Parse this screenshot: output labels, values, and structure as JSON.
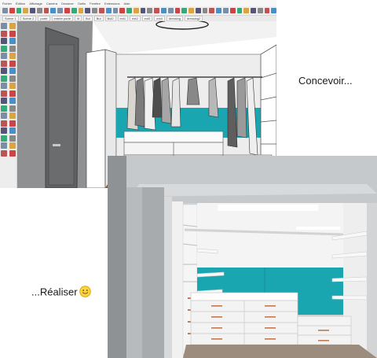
{
  "sketchup": {
    "menu": [
      "Fichier",
      "Édition",
      "Affichage",
      "Caméra",
      "Dessiner",
      "Outils",
      "Fenêtre",
      "Extensions",
      "Aide"
    ],
    "scene_tabs": [
      "Scène 1",
      "Scène 2",
      "porte",
      "entrée porte",
      "lit",
      "Bul",
      "Bul",
      "Bul2",
      "ext1",
      "ext2",
      "ext3",
      "ext4",
      "dressing",
      "dressing2"
    ]
  },
  "captions": {
    "design": "Concevoir...",
    "build": "...Réaliser"
  },
  "icons": [
    "smiley-emoji-icon"
  ],
  "colors": {
    "teal_wall": "#1aa6b0",
    "wall_grey": "#9ea0a2",
    "floor_brown": "#6b5a48",
    "drawer_white": "#f6f6f6",
    "handle_copper": "#c07a52"
  }
}
